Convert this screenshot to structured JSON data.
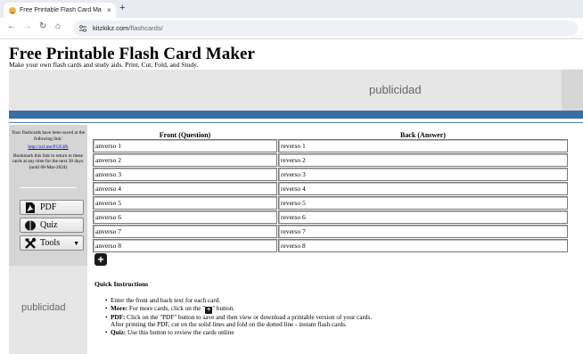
{
  "browser": {
    "tab_title": "Free Printable Flash Card Mak",
    "tab_close": "×",
    "new_tab": "+",
    "url_host": "kitzkikz.com",
    "url_path": "/flashcards/"
  },
  "page": {
    "title": "Free Printable Flash Card Maker",
    "subtitle": "Make your own flash cards and study aids. Print, Cut, Fold, and Study."
  },
  "ads": {
    "top_label": "publicidad",
    "side_label": "publicidad"
  },
  "sidebar": {
    "saved_text": "Your flashcards have been saved at the following link:",
    "saved_link": "http://zzl.me/FGE4fh",
    "bookmark_text": "Bookmark this link to return to these cards at any time for the next 30 days.",
    "until_text": "(until 08-Mar-2024)",
    "pdf_label": "PDF",
    "quiz_label": "Quiz",
    "tools_label": "Tools"
  },
  "table": {
    "front_header": "Front (Question)",
    "back_header": "Back (Answer)",
    "rows": [
      {
        "front": "anverso 1",
        "back": "reverso 1"
      },
      {
        "front": "anverso 2",
        "back": "reverso 2"
      },
      {
        "front": "anverso 3",
        "back": "reverso 3"
      },
      {
        "front": "anverso 4",
        "back": "reverso 4"
      },
      {
        "front": "anverso 5",
        "back": "reverso 5"
      },
      {
        "front": "anverso 6",
        "back": "reverso 6"
      },
      {
        "front": "anverso 7",
        "back": "reverso 7"
      },
      {
        "front": "anverso 8",
        "back": "reverso 8"
      }
    ],
    "add_label": "+"
  },
  "instructions": {
    "title": "Quick Instructions",
    "item1": "Enter the front and back text for each card.",
    "item2_bold": "More:",
    "item2_pre": " For more cards, click on the \"",
    "item2_post": "\" button.",
    "item3_bold": "PDF:",
    "item3_text": " Click on the \"PDF\" button to save and then view or download a printable version of your cards.",
    "item3_cont": "After printing the PDF, cut on the solid lines and fold on the dotted line - instant flash cards.",
    "item4_bold": "Quiz:",
    "item4_text": " Use this button to review the cards online"
  },
  "colors": {
    "accent_blue": "#3b6ea5",
    "sidebar_gray": "#d5d5d5",
    "ad_gray": "#e6e6e6"
  }
}
